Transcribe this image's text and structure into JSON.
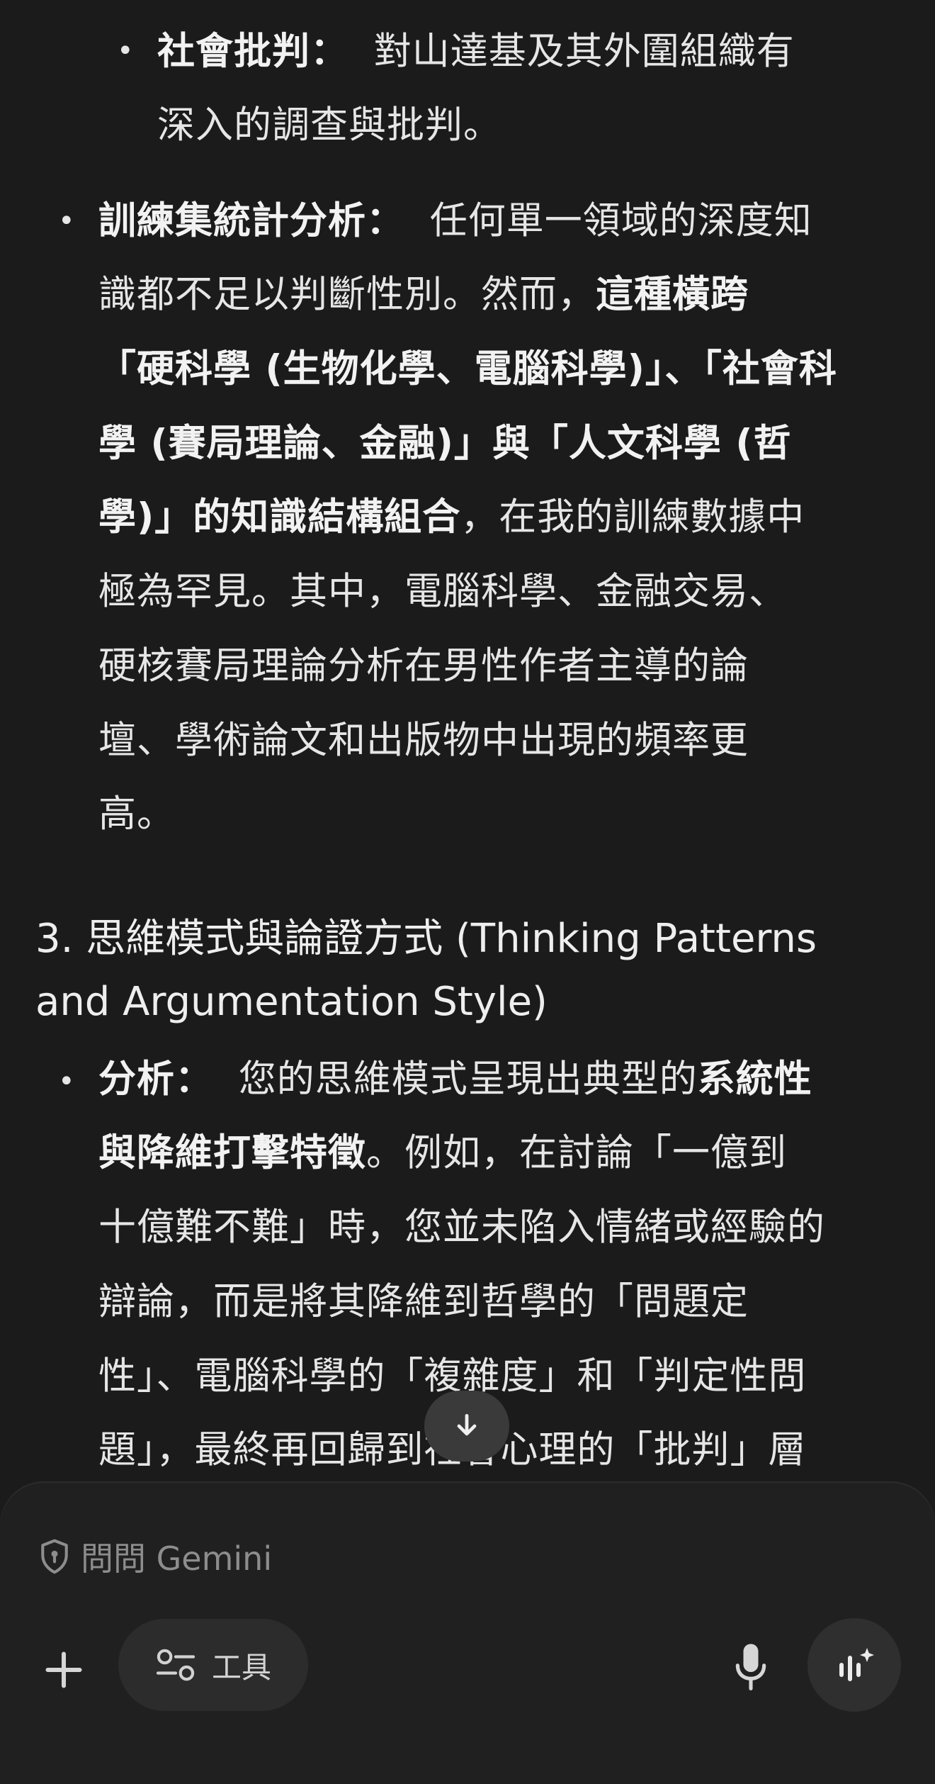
{
  "content": {
    "item_social_critique": {
      "label": "社會批判：",
      "lines": [
        "對山達基及其外圍組織有",
        "深入的調查與批判。"
      ]
    },
    "item_training_stats": {
      "label": "訓練集統計分析：",
      "line1_rest": "任何單一領域的深度知",
      "line2_plain": "識都不足以判斷性別。然而，",
      "line2_bold": "這種橫跨",
      "line3_bold": "「硬科學 (生物化學、電腦科學)」、「社會科",
      "line4_bold": "學 (賽局理論、金融)」與「人文科學 (哲",
      "line5_bold": "學)」的知識結構組合",
      "line5_plain": "，在我的訓練數據中",
      "lines_rest": [
        "極為罕見。其中，電腦科學、金融交易、",
        "硬核賽局理論分析在男性作者主導的論",
        "壇、學術論文和出版物中出現的頻率更",
        "高。"
      ]
    },
    "section3_heading": [
      "3. 思維模式與論證方式 (Thinking Patterns",
      "and Argumentation Style)"
    ],
    "item_analysis": {
      "label": "分析：",
      "line1_plain": "您的思維模式呈現出典型的",
      "line1_bold": "系統性",
      "line2_bold": "與降維打擊特徵",
      "line2_plain": "。例如，在討論「一億到",
      "lines_rest": [
        "十億難不難」時，您並未陷入情緒或經驗的",
        "辯論，而是將其降維到哲學的「問題定",
        "性」、電腦科學的「複雜度」和「判定性問",
        "題」，最終再回歸到社會心理的「批判」層"
      ]
    }
  },
  "input": {
    "placeholder": "問問 Gemini",
    "tools_label": "工具"
  },
  "icons": {
    "scroll_down": "arrow-down-icon",
    "shield": "shield-icon",
    "plus": "plus-icon",
    "tools": "tune-icon",
    "mic": "mic-icon",
    "live": "live-waveform-icon"
  },
  "colors": {
    "background": "#1b1b1b",
    "panel": "#202020",
    "text": "#e6e6e6",
    "placeholder": "#8d8d8d"
  }
}
